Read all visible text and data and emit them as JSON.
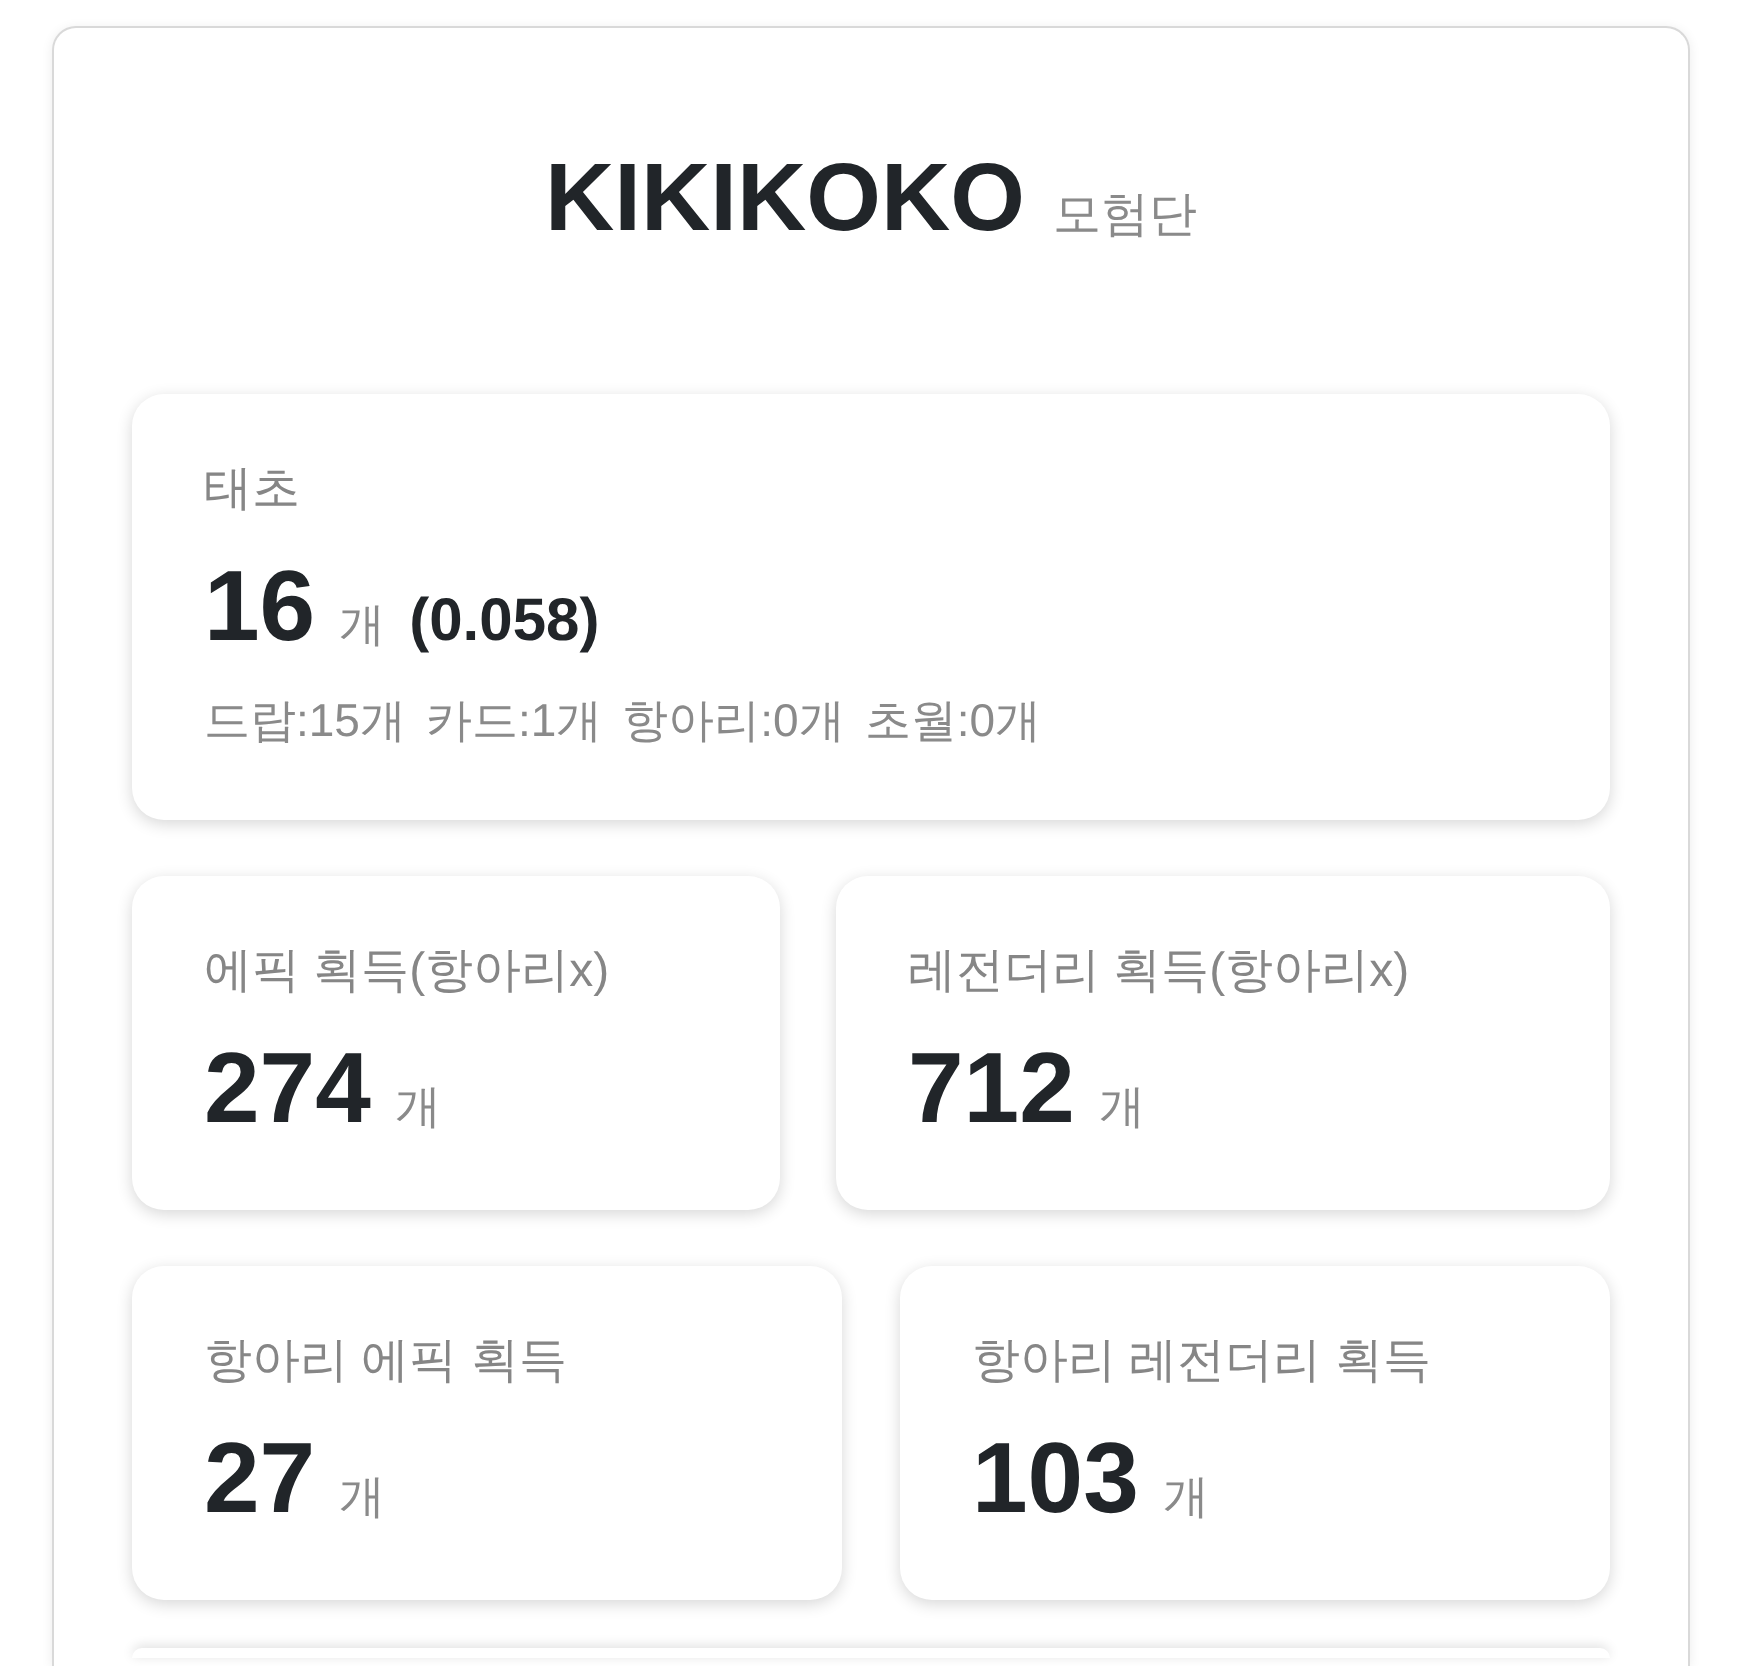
{
  "header": {
    "title": "KIKIKOKO",
    "subtitle": "모험단"
  },
  "rows": [
    [
      {
        "label": "태초",
        "value": "16",
        "unit": "개",
        "ratio": "(0.058)",
        "breakdown": [
          "드랍:15개",
          "카드:1개",
          "항아리:0개",
          "초월:0개"
        ]
      }
    ],
    [
      {
        "label": "에픽 획득(항아리x)",
        "value": "274",
        "unit": "개"
      },
      {
        "label": "레전더리 획득(항아리x)",
        "value": "712",
        "unit": "개"
      }
    ],
    [
      {
        "label": "항아리 에픽 획득",
        "value": "27",
        "unit": "개"
      },
      {
        "label": "항아리 레전더리 획득",
        "value": "103",
        "unit": "개"
      }
    ]
  ]
}
